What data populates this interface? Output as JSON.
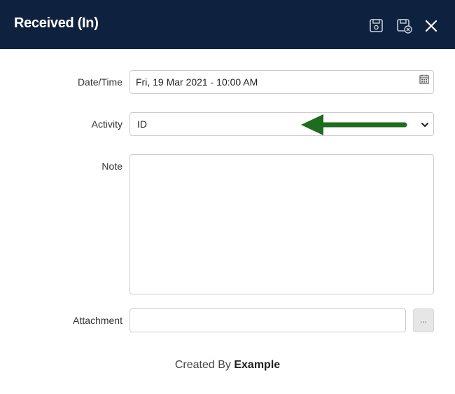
{
  "header": {
    "title": "Received (In)",
    "icons": [
      "save-icon",
      "save-and-close-icon",
      "close-icon"
    ]
  },
  "form": {
    "datetime": {
      "label": "Date/Time",
      "value": "Fri, 19 Mar 2021 - 10:00 AM",
      "icon": "calendar-icon"
    },
    "activity": {
      "label": "Activity",
      "value": "ID",
      "icon": "chevron-down-icon"
    },
    "note": {
      "label": "Note",
      "value": ""
    },
    "attachment": {
      "label": "Attachment",
      "value": "",
      "browse_label": "..."
    }
  },
  "footer": {
    "prefix": "Created By",
    "user": "Example"
  },
  "colors": {
    "header_bg": "#0e2240",
    "arrow": "#1f6b1f",
    "border": "#cccccc"
  }
}
